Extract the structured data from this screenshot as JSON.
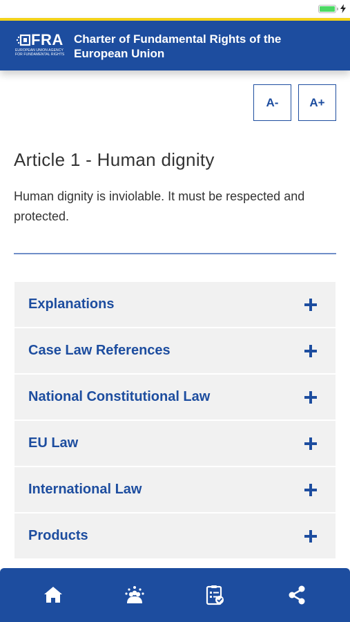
{
  "header": {
    "logo_text": "FRA",
    "logo_sub_line1": "EUROPEAN UNION AGENCY",
    "logo_sub_line2": "FOR FUNDAMENTAL RIGHTS",
    "title_line1": "Charter of Fundamental Rights of the",
    "title_line2": "European Union"
  },
  "font_controls": {
    "decrease_label": "A-",
    "increase_label": "A+"
  },
  "article": {
    "title": "Article 1 - Human dignity",
    "body": "Human dignity is inviolable. It must be respected and protected."
  },
  "sections": [
    {
      "label": "Explanations"
    },
    {
      "label": "Case Law References"
    },
    {
      "label": "National Constitutional Law"
    },
    {
      "label": "EU Law"
    },
    {
      "label": "International Law"
    },
    {
      "label": "Products"
    }
  ],
  "bottom_nav": {
    "items": [
      {
        "icon": "home-icon"
      },
      {
        "icon": "community-icon"
      },
      {
        "icon": "checklist-icon"
      },
      {
        "icon": "share-icon"
      }
    ]
  },
  "colors": {
    "brand_blue": "#1d4d9f",
    "accent_yellow": "#f2d21a",
    "row_bg": "#f1f1f1",
    "battery_green": "#4cd964"
  }
}
